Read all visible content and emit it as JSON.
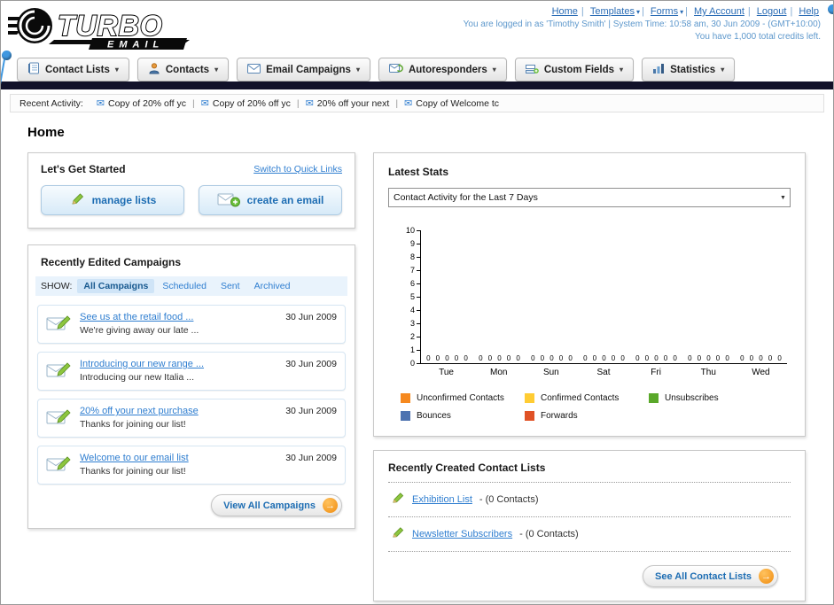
{
  "page_title": "Home",
  "colors": {
    "link_blue": "#2f7ed0",
    "dark_bar": "#12122a",
    "accent_orange": "#f08c0f",
    "panel_border": "#c9c9c9"
  },
  "header": {
    "logo_text": "TURBO",
    "logo_subtext": "EMAIL",
    "links": [
      {
        "label": "Home"
      },
      {
        "label": "Templates"
      },
      {
        "label": "Forms"
      },
      {
        "label": "My Account"
      },
      {
        "label": "Logout"
      },
      {
        "label": "Help"
      }
    ],
    "login_info": "You are logged in as 'Timothy Smith' | System Time: 10:58 am, 30 Jun 2009 - (GMT+10:00)",
    "credits_info": "You have 1,000 total credits left."
  },
  "nav": {
    "tabs": [
      {
        "label": "Contact Lists"
      },
      {
        "label": "Contacts"
      },
      {
        "label": "Email Campaigns"
      },
      {
        "label": "Autoresponders"
      },
      {
        "label": "Custom Fields"
      },
      {
        "label": "Statistics"
      }
    ]
  },
  "recent_activity": {
    "label": "Recent Activity:",
    "items": [
      "Copy of 20% off yc",
      "Copy of 20% off yc",
      "20% off your next",
      "Copy of Welcome tc"
    ]
  },
  "get_started": {
    "title": "Let's Get Started",
    "switch_link": "Switch to Quick Links",
    "buttons": [
      {
        "label": "manage lists"
      },
      {
        "label": "create an email"
      }
    ]
  },
  "campaigns": {
    "title": "Recently Edited Campaigns",
    "show_label": "SHOW:",
    "filters": [
      "All Campaigns",
      "Scheduled",
      "Sent",
      "Archived"
    ],
    "active_filter": "All Campaigns",
    "items": [
      {
        "title": "See us at the retail food ...",
        "subtitle": "We're giving away our late ...",
        "date": "30 Jun 2009"
      },
      {
        "title": "Introducing our new range ...",
        "subtitle": "Introducing our new Italia ...",
        "date": "30 Jun 2009"
      },
      {
        "title": "20% off your next purchase",
        "subtitle": "Thanks for joining our list!",
        "date": "30 Jun 2009"
      },
      {
        "title": "Welcome to our email list",
        "subtitle": "Thanks for joining our list!",
        "date": "30 Jun 2009"
      }
    ],
    "view_all_label": "View All Campaigns"
  },
  "stats": {
    "title": "Latest Stats",
    "dropdown_value": "Contact Activity for the Last 7 Days"
  },
  "chart_data": {
    "type": "bar",
    "title": "Contact Activity for the Last 7 Days",
    "categories": [
      "Tue",
      "Mon",
      "Sun",
      "Sat",
      "Fri",
      "Thu",
      "Wed"
    ],
    "series": [
      {
        "name": "Unconfirmed Contacts",
        "color": "#f6891f",
        "values": [
          0,
          0,
          0,
          0,
          0,
          0,
          0
        ]
      },
      {
        "name": "Confirmed Contacts",
        "color": "#ffcc33",
        "values": [
          0,
          0,
          0,
          0,
          0,
          0,
          0
        ]
      },
      {
        "name": "Unsubscribes",
        "color": "#5aa82a",
        "values": [
          0,
          0,
          0,
          0,
          0,
          0,
          0
        ]
      },
      {
        "name": "Bounces",
        "color": "#4e73b0",
        "values": [
          0,
          0,
          0,
          0,
          0,
          0,
          0
        ]
      },
      {
        "name": "Forwards",
        "color": "#e05226",
        "values": [
          0,
          0,
          0,
          0,
          0,
          0,
          0
        ]
      }
    ],
    "ylim": [
      0,
      10
    ],
    "yticks": [
      0,
      1,
      2,
      3,
      4,
      5,
      6,
      7,
      8,
      9,
      10
    ],
    "grid": false,
    "legend_position": "bottom"
  },
  "contact_lists": {
    "title": "Recently Created Contact Lists",
    "items": [
      {
        "name": "Exhibition List",
        "detail": "- (0 Contacts)"
      },
      {
        "name": "Newsletter Subscribers",
        "detail": "- (0 Contacts)"
      }
    ],
    "see_all_label": "See All Contact Lists"
  }
}
